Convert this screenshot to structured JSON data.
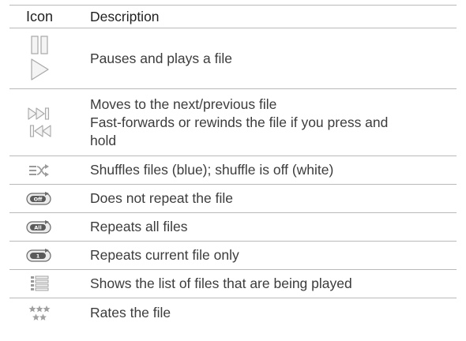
{
  "header": {
    "icon": "Icon",
    "description": "Description"
  },
  "rows": [
    {
      "icons": [
        "pause-icon",
        "play-icon"
      ],
      "lines": [
        "Pauses and plays a file"
      ]
    },
    {
      "icons": [
        "next-icon",
        "previous-icon"
      ],
      "lines": [
        "Moves to the next/previous file",
        "Fast-forwards or rewinds the file if you press and",
        "hold"
      ]
    },
    {
      "icons": [
        "shuffle-icon"
      ],
      "lines": [
        "Shuffles files (blue); shuffle is off (white)"
      ],
      "color": "#9a9a9a"
    },
    {
      "icons": [
        "repeat-off-icon"
      ],
      "icon_text": "Off",
      "lines": [
        "Does not repeat the file"
      ]
    },
    {
      "icons": [
        "repeat-all-icon"
      ],
      "icon_text": "All",
      "lines": [
        "Repeats all files"
      ]
    },
    {
      "icons": [
        "repeat-one-icon"
      ],
      "icon_text": "1",
      "lines": [
        "Repeats current file only"
      ]
    },
    {
      "icons": [
        "playlist-icon"
      ],
      "lines": [
        "Shows the list of files that are being played"
      ]
    },
    {
      "icons": [
        "rating-icon"
      ],
      "lines": [
        "Rates the file"
      ]
    }
  ],
  "colors": {
    "icon_gray": "#a8a8a8",
    "icon_dark": "#5a5a5a",
    "rule": "#b9b9b9"
  }
}
